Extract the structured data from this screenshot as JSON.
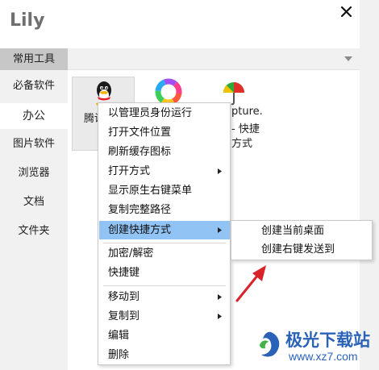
{
  "app": {
    "title": "Lily"
  },
  "sidebar": {
    "group_label": "常用工具",
    "items": [
      {
        "label": "必备软件"
      },
      {
        "label": "办公"
      },
      {
        "label": "图片软件"
      },
      {
        "label": "浏览器"
      },
      {
        "label": "文档"
      },
      {
        "label": "文件夹"
      }
    ],
    "active_index": 1
  },
  "tiles": [
    {
      "icon": "qq-penguin-icon",
      "label": "腾讯"
    },
    {
      "icon": "colorful-ring-icon"
    },
    {
      "icon": "umbrella-capture-icon",
      "label_lines": [
        "pture.",
        "- 快捷",
        "方式"
      ]
    }
  ],
  "context_menu": {
    "items": [
      {
        "label": "以管理员身份运行"
      },
      {
        "label": "打开文件位置"
      },
      {
        "label": "刷新缓存图标"
      },
      {
        "label": "打开方式",
        "submenu": true
      },
      {
        "label": "显示原生右键菜单"
      },
      {
        "label": "复制完整路径"
      },
      {
        "label": "创建快捷方式",
        "submenu": true,
        "highlighted": true
      },
      {
        "label": "加密/解密"
      },
      {
        "label": "快捷键"
      },
      {
        "label": "移动到",
        "submenu": true
      },
      {
        "label": "复制到",
        "submenu": true
      },
      {
        "label": "编辑"
      },
      {
        "label": "删除"
      }
    ]
  },
  "submenu": {
    "items": [
      {
        "label": "创建当前桌面"
      },
      {
        "label": "创建右键发送到"
      }
    ]
  },
  "watermark": {
    "text": "极光下载站",
    "url": "www.xz7.com"
  },
  "colors": {
    "highlight": "#91c3f5",
    "sidebar_group": "#c7c7c7",
    "arrow_red": "#d9232a",
    "watermark_blue": "#2a62b8"
  }
}
